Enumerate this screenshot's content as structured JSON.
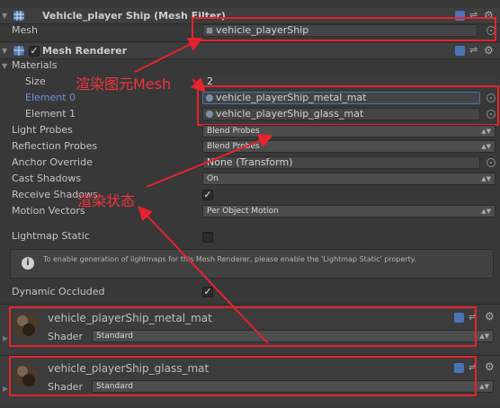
{
  "mesh_filter": {
    "title": "Vehicle_player Ship (Mesh Filter)",
    "mesh_label": "Mesh",
    "mesh_value": "vehicle_playerShip"
  },
  "mesh_renderer": {
    "title": "Mesh Renderer",
    "materials_label": "Materials",
    "size_label": "Size",
    "size_value": "2",
    "element0_label": "Element 0",
    "element0_value": "vehicle_playerShip_metal_mat",
    "element1_label": "Element 1",
    "element1_value": "vehicle_playerShip_glass_mat",
    "light_probes_label": "Light Probes",
    "light_probes_value": "Blend Probes",
    "reflection_probes_label": "Reflection Probes",
    "reflection_probes_value": "Blend Probes",
    "anchor_override_label": "Anchor Override",
    "anchor_override_value": "None (Transform)",
    "cast_shadows_label": "Cast Shadows",
    "cast_shadows_value": "On",
    "receive_shadows_label": "Receive Shadows",
    "motion_vectors_label": "Motion Vectors",
    "motion_vectors_value": "Per Object Motion",
    "lightmap_static_label": "Lightmap Static",
    "info_text": "To enable generation of lightmaps for this Mesh Renderer, please enable the 'Lightmap Static' property.",
    "dynamic_occluded_label": "Dynamic Occluded"
  },
  "materials": [
    {
      "name": "vehicle_playerShip_metal_mat",
      "shader_label": "Shader",
      "shader_value": "Standard"
    },
    {
      "name": "vehicle_playerShip_glass_mat",
      "shader_label": "Shader",
      "shader_value": "Standard"
    }
  ],
  "annotations": {
    "render_mesh": "渲染图元Mesh",
    "render_state": "渲染状态"
  },
  "colors": {
    "highlight_red": "#e8222c",
    "element0_blue": "#6f8fd8",
    "background": "#383838"
  }
}
